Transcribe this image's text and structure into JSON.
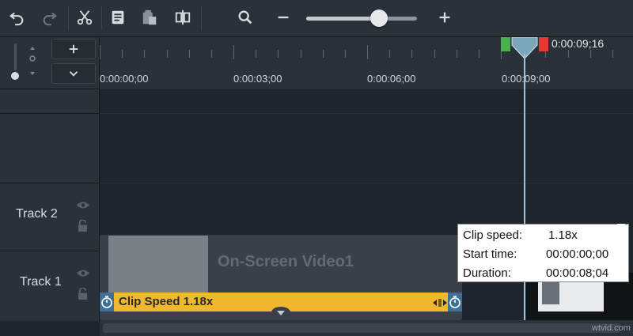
{
  "toolbar": {
    "icons": [
      "undo-icon",
      "redo-icon",
      "scissors-icon",
      "note-icon",
      "paste-icon",
      "split-icon",
      "search-icon",
      "minus-icon",
      "plus-icon"
    ],
    "zoom_level": 0.66
  },
  "timeline": {
    "ruler_labels": [
      "0:00:00;00",
      "0:00:03;00",
      "0:00:06;00",
      "0:00:09;00"
    ],
    "playhead_time": "0:00:09;16",
    "colors": {
      "in_marker": "#4caf50",
      "out_marker": "#e53935",
      "playhead": "#7ba7b9"
    }
  },
  "tracks": [
    {
      "name": "Track 2"
    },
    {
      "name": "Track 1"
    }
  ],
  "clip": {
    "title": "On-Screen Video1",
    "speed_label": "Clip Speed 1.18x"
  },
  "tooltip": {
    "rows": [
      {
        "label": "Clip speed:",
        "value": "1.18x"
      },
      {
        "label": "Start time:",
        "value": "00:00:00;00"
      },
      {
        "label": "Duration:",
        "value": "00:00:08;04"
      }
    ]
  },
  "watermark": "wtvid.com"
}
